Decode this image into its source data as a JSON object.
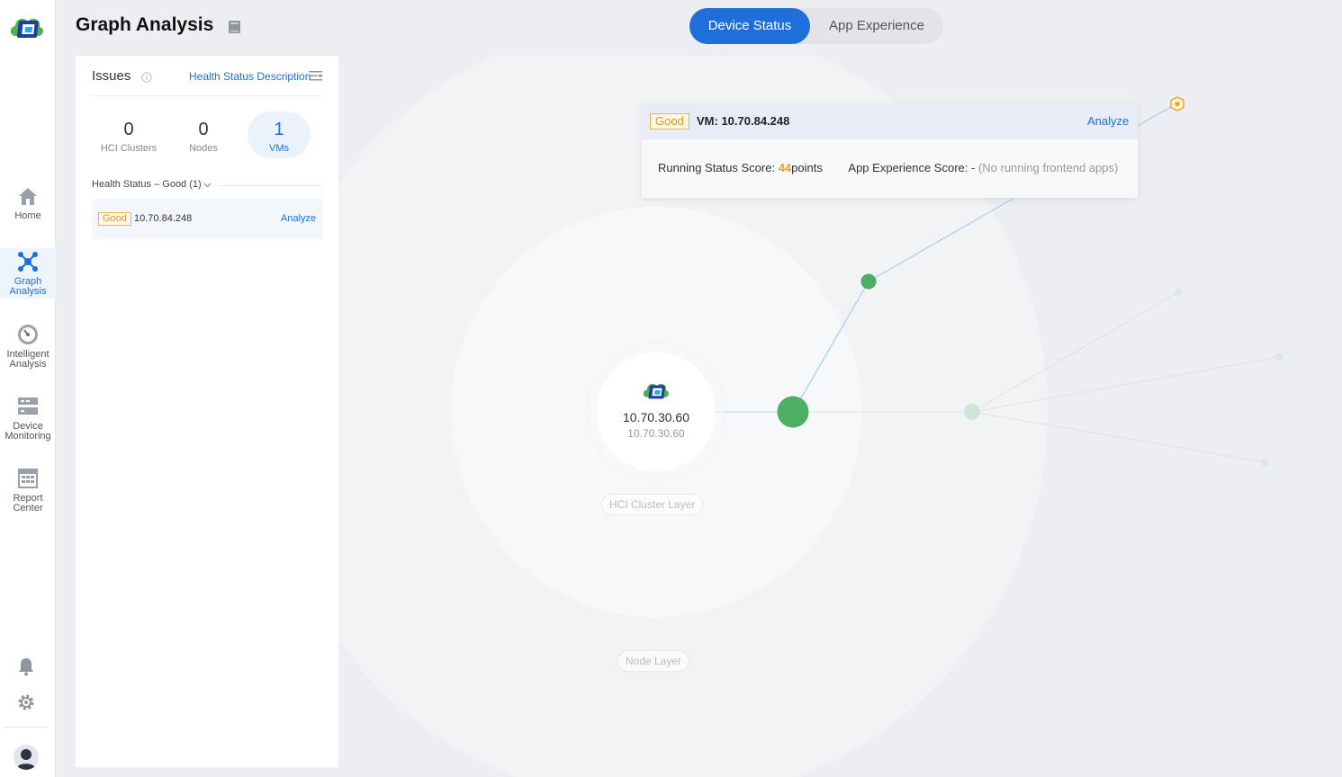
{
  "app": {
    "page_title": "Graph Analysis"
  },
  "sidebar": {
    "items": [
      {
        "label_1": "Home",
        "label_2": "",
        "icon": "home-icon"
      },
      {
        "label_1": "Graph",
        "label_2": "Analysis",
        "icon": "graph-icon",
        "active": true
      },
      {
        "label_1": "Intelligent",
        "label_2": "Analysis",
        "icon": "gauge-icon"
      },
      {
        "label_1": "Device",
        "label_2": "Monitoring",
        "icon": "monitor-icon"
      },
      {
        "label_1": "Report",
        "label_2": "Center",
        "icon": "calendar-report-icon"
      }
    ],
    "bottom_icons": [
      "bell-icon",
      "gear-icon",
      "avatar"
    ]
  },
  "tabs": {
    "device_status": "Device Status",
    "app_experience": "App Experience",
    "active": "Device Status"
  },
  "issues_panel": {
    "title": "Issues",
    "health_link": "Health Status Description",
    "stats": [
      {
        "value": "0",
        "label": "HCI Clusters"
      },
      {
        "value": "0",
        "label": "Nodes"
      },
      {
        "value": "1",
        "label": "VMs",
        "active": true
      }
    ],
    "group_label": "Health Status – Good (1)",
    "rows": [
      {
        "status": "Good",
        "ip": "10.70.84.248",
        "action": "Analyze"
      }
    ]
  },
  "graph": {
    "center_ip": "10.70.30.60",
    "center_sub_ip": "10.70.30.60",
    "layers": {
      "hci": "HCI Cluster Layer",
      "node": "Node Layer"
    }
  },
  "tooltip": {
    "status": "Good",
    "vm": "VM: 10.70.84.248",
    "action": "Analyze",
    "running_label": "Running Status Score: ",
    "running_score": "44",
    "running_unit": "points",
    "app_label": "App Experience Score: - ",
    "app_note": "(No running frontend apps)"
  },
  "colors": {
    "accent": "#1e6fd9",
    "good_node": "#4caf64",
    "faded_node": "#cfe6d6",
    "warning": "#f0a020"
  }
}
